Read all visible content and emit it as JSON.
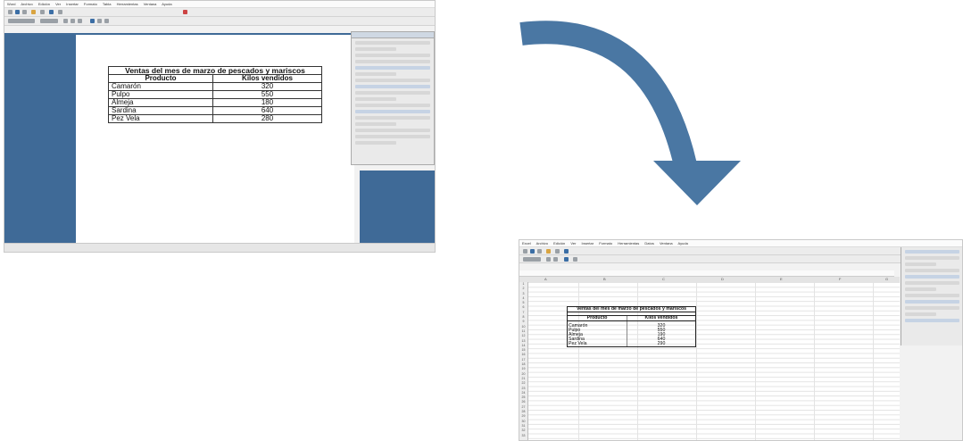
{
  "writer": {
    "menu": [
      "Word",
      "Archivo",
      "Edición",
      "Ver",
      "Insertar",
      "Formato",
      "Tabla",
      "Herramientas",
      "Ventana",
      "Ayuda"
    ],
    "table_title": "Ventas del mes de marzo de pescados y mariscos",
    "headers": [
      "Producto",
      "Kilos vendidos"
    ],
    "rows": [
      {
        "producto": "Camarón",
        "kilos": "320"
      },
      {
        "producto": "Pulpo",
        "kilos": "550"
      },
      {
        "producto": "Almeja",
        "kilos": "180"
      },
      {
        "producto": "Sardina",
        "kilos": "640"
      },
      {
        "producto": "Pez Vela",
        "kilos": "280"
      }
    ]
  },
  "calc": {
    "menu": [
      "Excel",
      "Archivo",
      "Edición",
      "Ver",
      "Insertar",
      "Formato",
      "Herramientas",
      "Datos",
      "Ventana",
      "Ayuda"
    ],
    "column_headers": [
      "A",
      "B",
      "C",
      "D",
      "E",
      "F",
      "G"
    ],
    "row_numbers": [
      "1",
      "2",
      "3",
      "4",
      "5",
      "6",
      "7",
      "8",
      "9",
      "10",
      "11",
      "12",
      "13",
      "14",
      "15",
      "16",
      "17",
      "18",
      "19",
      "20",
      "21",
      "22",
      "23",
      "24",
      "25",
      "26",
      "27",
      "28",
      "29",
      "30",
      "31",
      "32",
      "33"
    ],
    "table_title": "Ventas del mes de marzo de pescados y mariscos",
    "headers": [
      "Producto",
      "Kilos vendidos"
    ],
    "rows": [
      {
        "producto": "Camarón",
        "kilos": "320"
      },
      {
        "producto": "Pulpo",
        "kilos": "550"
      },
      {
        "producto": "Almeja",
        "kilos": "190"
      },
      {
        "producto": "Sardina",
        "kilos": "640"
      },
      {
        "producto": "Pez Vela",
        "kilos": "290"
      }
    ]
  },
  "colors": {
    "workspace_blue": "#3f6a97",
    "arrow": "#4a77a3"
  }
}
